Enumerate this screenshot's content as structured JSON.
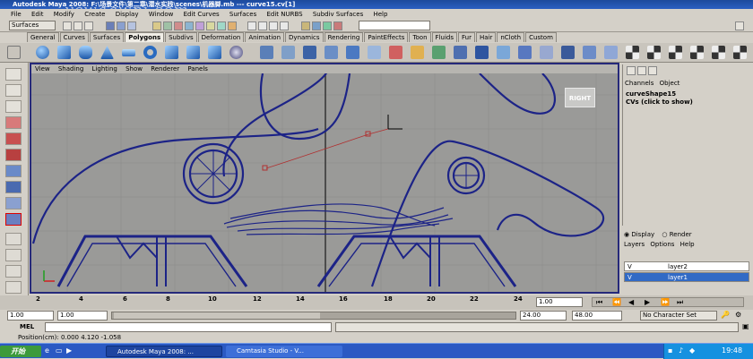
{
  "window": {
    "title": "Autodesk Maya 2008: F:\\场景文件\\第二章\\潜水实践\\scenes\\机器脚.mb  ---  curve15.cv[1]"
  },
  "watermark": {
    "text": "ycwaqwpj.com"
  },
  "menubar": [
    "File",
    "Edit",
    "Modify",
    "Create",
    "Display",
    "Window",
    "Edit Curves",
    "Surfaces",
    "Edit NURBS",
    "Subdiv Surfaces",
    "Help"
  ],
  "statusline": {
    "mode": "Surfaces"
  },
  "shelf_tabs": [
    {
      "label": "General",
      "active": false
    },
    {
      "label": "Curves",
      "active": false
    },
    {
      "label": "Surfaces",
      "active": false
    },
    {
      "label": "Polygons",
      "active": true
    },
    {
      "label": "Subdivs",
      "active": false
    },
    {
      "label": "Deformation",
      "active": false
    },
    {
      "label": "Animation",
      "active": false
    },
    {
      "label": "Dynamics",
      "active": false
    },
    {
      "label": "Rendering",
      "active": false
    },
    {
      "label": "PaintEffects",
      "active": false
    },
    {
      "label": "Toon",
      "active": false
    },
    {
      "label": "Fluids",
      "active": false
    },
    {
      "label": "Fur",
      "active": false
    },
    {
      "label": "Hair",
      "active": false
    },
    {
      "label": "nCloth",
      "active": false
    },
    {
      "label": "Custom",
      "active": false
    }
  ],
  "viewport": {
    "menu": [
      "View",
      "Shading",
      "Lighting",
      "Show",
      "Renderer",
      "Panels"
    ],
    "camera_label": "RIGHT"
  },
  "channel_box": {
    "menu": [
      "Channels",
      "Object"
    ],
    "node": "curveShape15",
    "cvs_label": "CVs (click to show)"
  },
  "layer_editor": {
    "display_label": "Display",
    "render_label": "Render",
    "menu": [
      "Layers",
      "Options",
      "Help"
    ],
    "layers": [
      {
        "vis": "V",
        "name": "layer2",
        "selected": false
      },
      {
        "vis": "V",
        "name": "layer1",
        "selected": true
      }
    ]
  },
  "timeline": {
    "ticks": [
      "2",
      "4",
      "6",
      "8",
      "10",
      "12",
      "14",
      "16",
      "18",
      "20",
      "22",
      "24"
    ],
    "current": "1"
  },
  "range": {
    "start": "1.00",
    "start2": "1.00",
    "current": "1.00",
    "end": "24.00",
    "end2": "48.00",
    "character": "No Character Set"
  },
  "mel": {
    "label": "MEL"
  },
  "helpline": {
    "text": "Position(cm): 0.000     4.120     -1.058"
  },
  "taskbar": {
    "start": "开始",
    "tasks": [
      "Autodesk Maya 2008: ...",
      "Camtasia Studio - V..."
    ],
    "clock": "19:48"
  },
  "colors": {
    "curve": "#1c2387",
    "viewport_bg": "#9a9a98",
    "selection": "#316ac5"
  }
}
